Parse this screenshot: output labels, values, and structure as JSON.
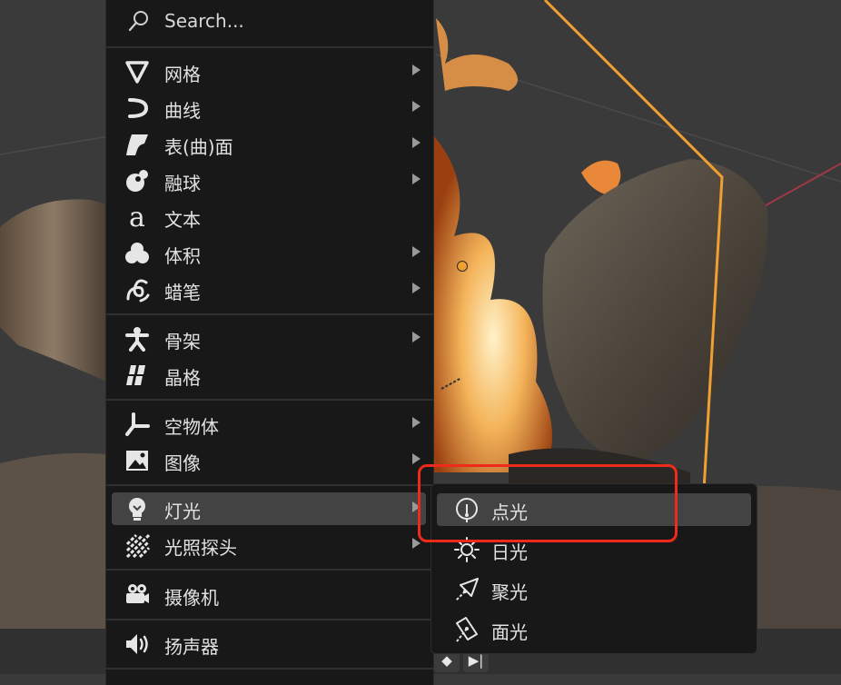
{
  "search": {
    "label": "Search..."
  },
  "menu": {
    "items": [
      {
        "label": "网格",
        "icon": "mesh-icon",
        "has_submenu": true
      },
      {
        "label": "曲线",
        "icon": "curve-icon",
        "has_submenu": true
      },
      {
        "label": "表(曲)面",
        "icon": "surface-icon",
        "has_submenu": true
      },
      {
        "label": "融球",
        "icon": "metaball-icon",
        "has_submenu": true
      },
      {
        "label": "文本",
        "icon": "text-icon",
        "has_submenu": false
      },
      {
        "label": "体积",
        "icon": "volume-icon",
        "has_submenu": true
      },
      {
        "label": "蜡笔",
        "icon": "grease-pencil-icon",
        "has_submenu": true
      },
      {
        "label": "骨架",
        "icon": "armature-icon",
        "has_submenu": true
      },
      {
        "label": "晶格",
        "icon": "lattice-icon",
        "has_submenu": false
      },
      {
        "label": "空物体",
        "icon": "empty-icon",
        "has_submenu": true
      },
      {
        "label": "图像",
        "icon": "image-icon",
        "has_submenu": true
      },
      {
        "label": "灯光",
        "icon": "light-bulb-icon",
        "has_submenu": true,
        "active": true
      },
      {
        "label": "光照探头",
        "icon": "light-probe-icon",
        "has_submenu": true
      },
      {
        "label": "摄像机",
        "icon": "camera-icon",
        "has_submenu": false
      },
      {
        "label": "扬声器",
        "icon": "speaker-icon",
        "has_submenu": false
      }
    ]
  },
  "light_submenu": {
    "items": [
      {
        "label": "点光",
        "icon": "point-light-icon",
        "active": true
      },
      {
        "label": "日光",
        "icon": "sun-light-icon"
      },
      {
        "label": "聚光",
        "icon": "spot-light-icon"
      },
      {
        "label": "面光",
        "icon": "area-light-icon"
      }
    ]
  },
  "colors": {
    "menu_bg": "#181818",
    "hover_bg": "#434343",
    "highlight": "#ee2a1a",
    "selection_outline": "#f0a030"
  }
}
